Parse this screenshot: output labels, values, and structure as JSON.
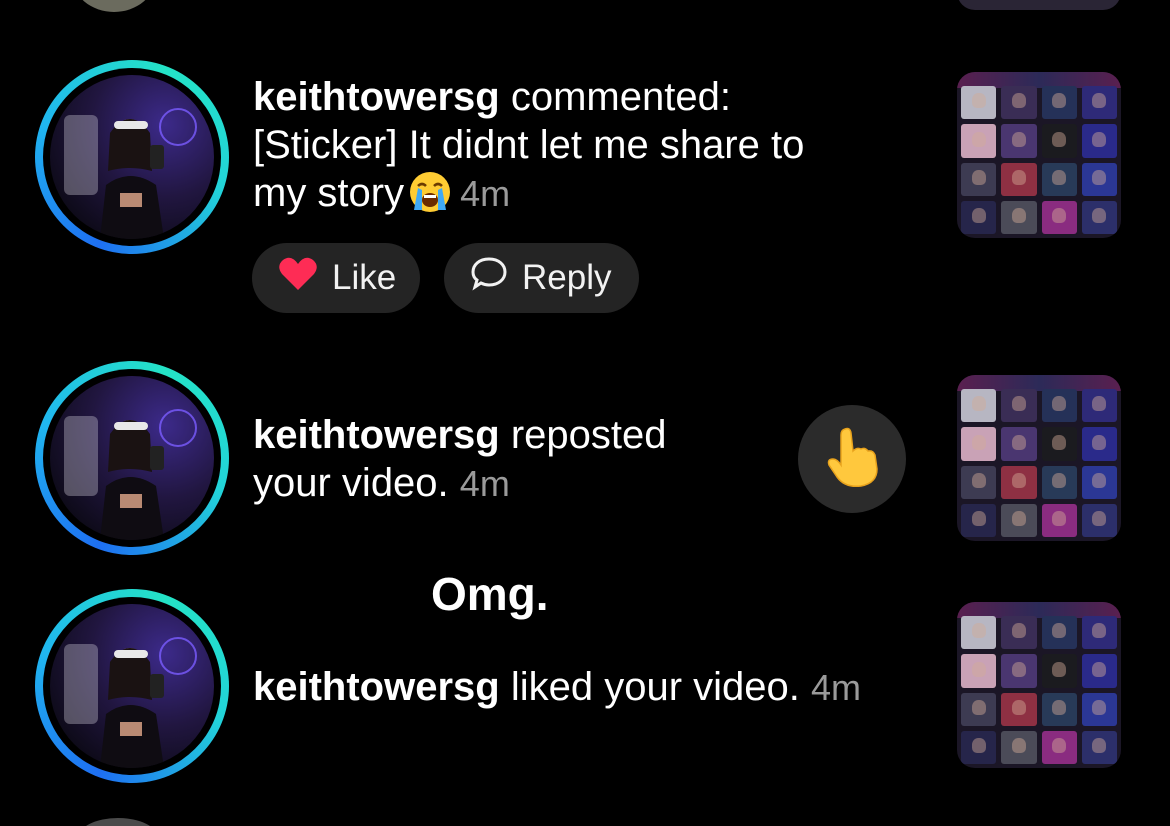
{
  "notifications": [
    {
      "username": "keithtowersg",
      "action": " commented:",
      "comment_line1": "[Sticker] It didnt let me share to",
      "comment_line2": "my story",
      "time": "4m",
      "like_label": "Like",
      "reply_label": "Reply"
    },
    {
      "username": "keithtowersg",
      "action_line1": " reposted",
      "action_line2": "your video.",
      "time": "4m"
    },
    {
      "username": "keithtowersg",
      "action": " liked your video.",
      "time": "4m"
    }
  ],
  "overlay_caption": "Omg.",
  "icons": {
    "cry": "loudly-crying-face-icon",
    "like": "heart-icon",
    "reply": "speech-bubble-icon",
    "repost_reaction": "pointing-hand-icon"
  },
  "colors": {
    "background": "#000000",
    "ring_start": "#1e6ff2",
    "ring_end": "#24e3c6",
    "heart": "#fe2c55",
    "pill": "#242424",
    "time": "#9a9a9a"
  }
}
